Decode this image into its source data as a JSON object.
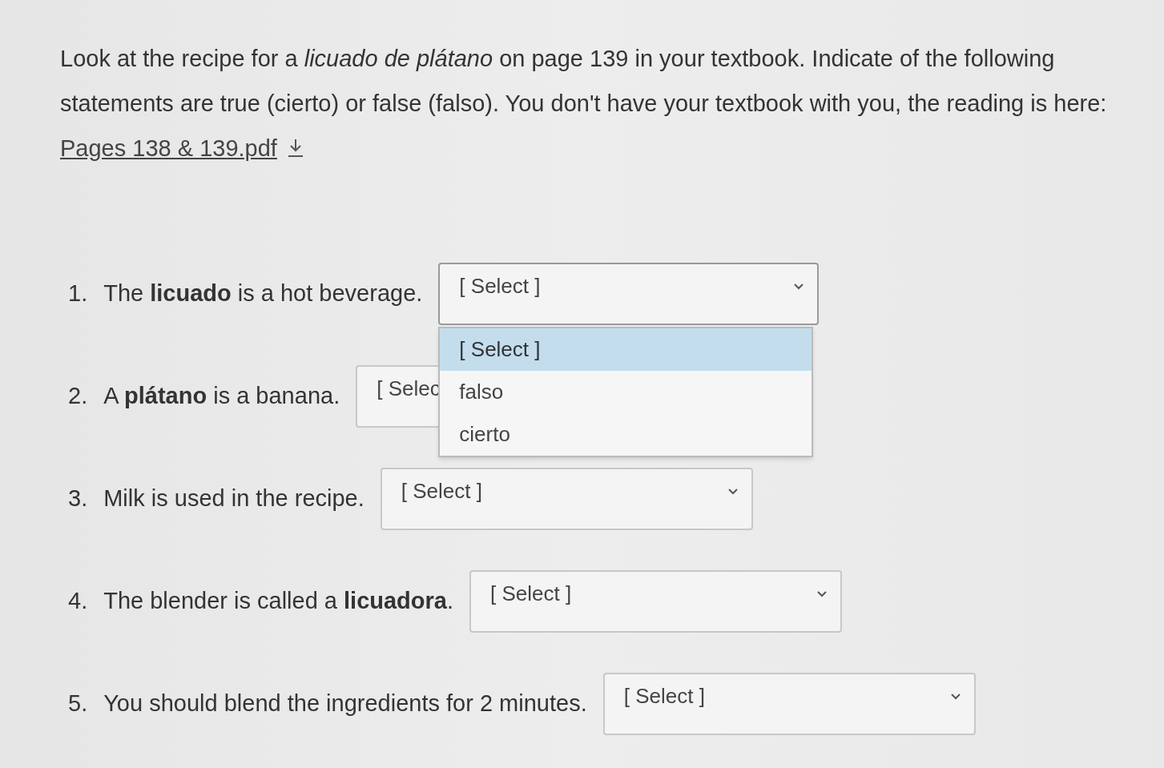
{
  "intro": {
    "text": "Look at the recipe for a *licuado de plátano* on page 139 in your textbook.  Indicate of the following statements are true (cierto) or false (falso).   You don't have your textbook with you, the reading is here: ",
    "link": "Pages 138 & 139.pdf"
  },
  "questions": [
    {
      "number": "1.",
      "text": "The **licuado** is a hot beverage.",
      "value": "[ Select ]",
      "expanded": true,
      "options": [
        {
          "label": "[ Select ]",
          "selected": true
        },
        {
          "label": "falso",
          "selected": false
        },
        {
          "label": "cierto",
          "selected": false
        }
      ]
    },
    {
      "number": "2.",
      "text": "A **plátano** is a banana.",
      "value": "[ Selec",
      "expanded": false
    },
    {
      "number": "3.",
      "text": "Milk is used in the recipe.",
      "value": "[ Select ]",
      "expanded": false
    },
    {
      "number": "4.",
      "text": "The blender is called a **licuadora**.",
      "value": "[ Select ]",
      "expanded": false
    },
    {
      "number": "5.",
      "text": "You should blend the ingredients for 2 minutes.",
      "value": "[ Select ]",
      "expanded": false
    }
  ]
}
